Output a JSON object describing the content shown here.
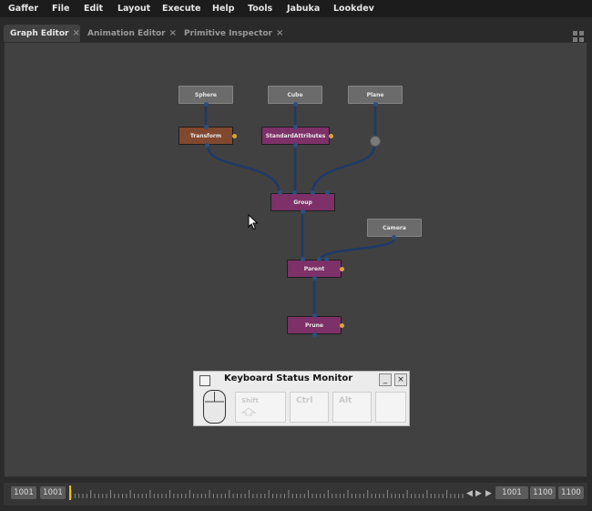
{
  "menubar": [
    "Gaffer",
    "File",
    "Edit",
    "Layout",
    "Execute",
    "Help",
    "Tools",
    "Jabuka",
    "Lookdev"
  ],
  "tabs": [
    {
      "label": "Graph Editor",
      "active": true
    },
    {
      "label": "Animation Editor",
      "active": false
    },
    {
      "label": "Primitive Inspector",
      "active": false
    }
  ],
  "tab_close_glyph": "×",
  "nodes": {
    "sphere": "Sphere",
    "cube": "Cube",
    "plane": "Plane",
    "transform": "Transform",
    "standard_attributes": "StandardAttributes",
    "group": "Group",
    "camera": "Camera",
    "parent": "Parent",
    "prune": "Prune"
  },
  "keyboard_monitor": {
    "title": "Keyboard Status Monitor",
    "minimize": "_",
    "close": "×",
    "keys": [
      "Shift",
      "Ctrl",
      "Alt",
      ""
    ]
  },
  "timeline": {
    "start": "1001",
    "current": "1001",
    "range_start": "1001",
    "range_end": "1100",
    "end": "1100"
  },
  "colors": {
    "menubar": "#1c1c1c",
    "graph_bg": "#414141",
    "node_gray": "#6b6b6b",
    "node_brown": "#80482e",
    "node_purple": "#7d3168",
    "edge": "#1f3a66",
    "output_plug": "#d7a63c",
    "playhead": "#e6c21a"
  }
}
